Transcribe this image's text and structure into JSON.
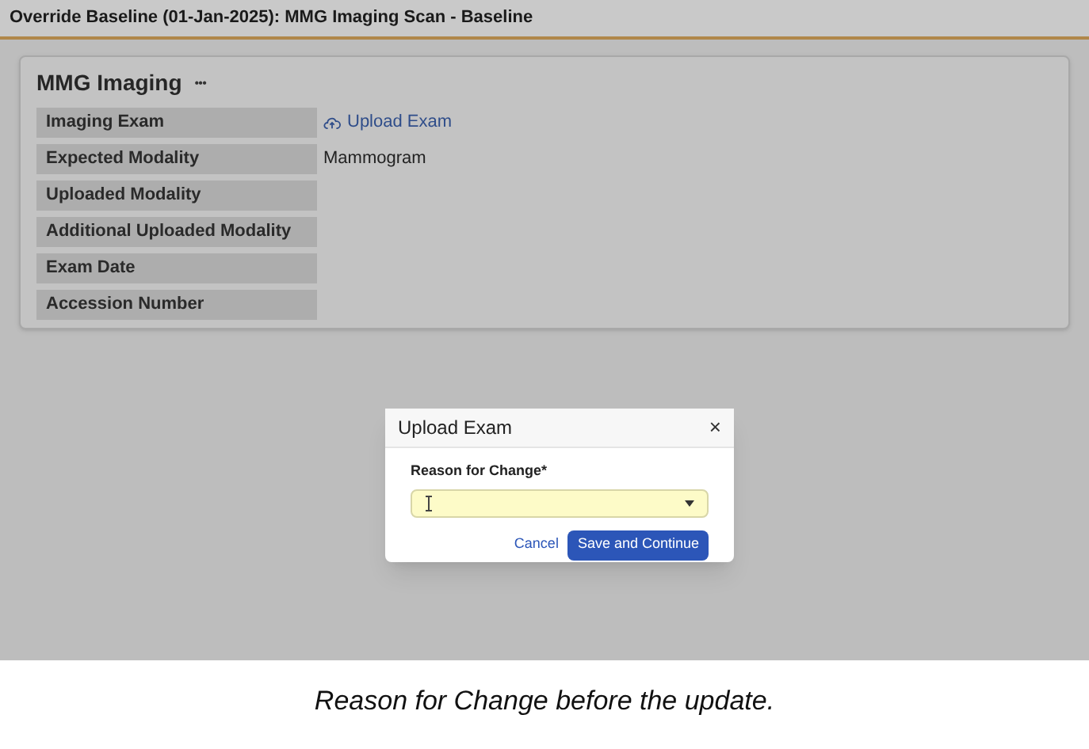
{
  "header": {
    "title": "Override Baseline (01-Jan-2025): MMG Imaging Scan - Baseline"
  },
  "card": {
    "title": "MMG Imaging",
    "menu": "•••",
    "fields": [
      {
        "label": "Imaging Exam",
        "kind": "link",
        "value": "Upload Exam"
      },
      {
        "label": "Expected Modality",
        "kind": "text",
        "value": "Mammogram"
      },
      {
        "label": "Uploaded Modality"
      },
      {
        "label": "Additional Uploaded Modality"
      },
      {
        "label": "Exam Date"
      },
      {
        "label": "Accession Number"
      }
    ]
  },
  "dialog": {
    "title": "Upload Exam",
    "close": "×",
    "field_label": "Reason for Change*",
    "buttons": [
      {
        "label": "Cancel",
        "kind": "link"
      },
      {
        "label": "Save and Continue",
        "kind": "primary"
      }
    ]
  },
  "caption": "Reason for Change before the update."
}
